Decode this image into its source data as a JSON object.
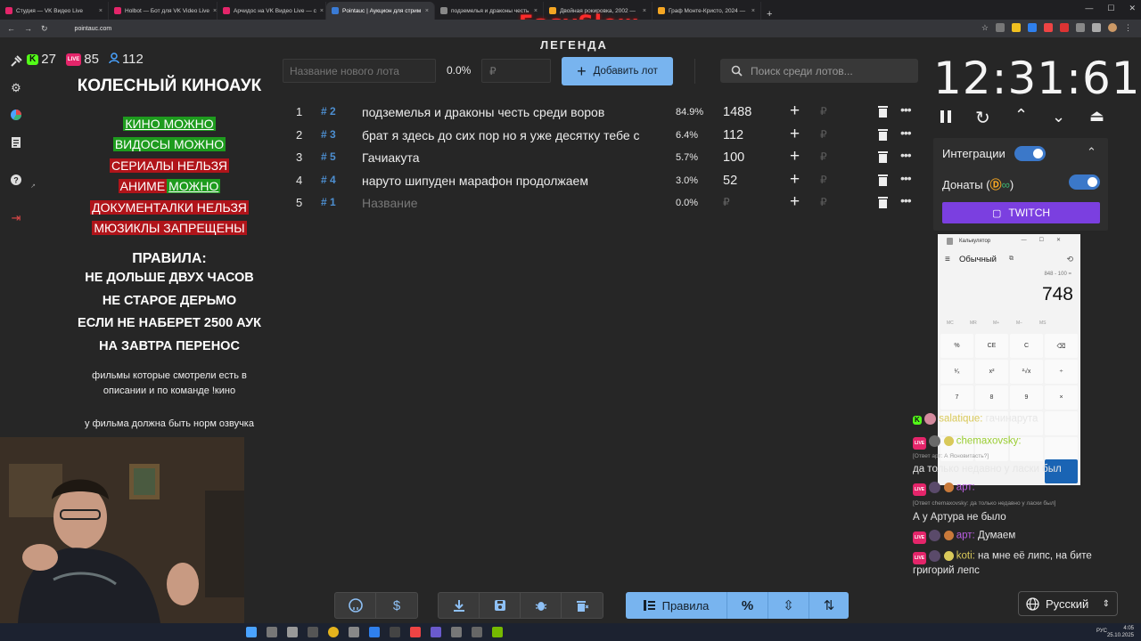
{
  "browser": {
    "tabs": [
      {
        "title": "Студия — VK Видео Live",
        "color": "#e4256a"
      },
      {
        "title": "Holbot — Бот для VK Video Live",
        "color": "#e4256a"
      },
      {
        "title": "Арчидос на VK Видео Live — с",
        "color": "#e4256a"
      },
      {
        "title": "Pointauc | Аукцион для стрим",
        "color": "#3a7bd5"
      },
      {
        "title": "подземелья и драконы честь",
        "color": "#888888"
      },
      {
        "title": "Двойная рокировка, 2002 —",
        "color": "#f5a623"
      },
      {
        "title": "Граф Монте-Кристо, 2024 —",
        "color": "#f5a623"
      }
    ],
    "url": "pointauc.com",
    "overlay_brand": "EasySlow"
  },
  "page": {
    "legend": "ЛЕГЕНДА"
  },
  "counters": {
    "kick": "27",
    "vk_live": "85",
    "viewers": "112",
    "kick_badge": "K",
    "live_badge": "LIVE"
  },
  "sidebar_icons": [
    "gavel-icon",
    "settings-icon",
    "chart-icon",
    "clipboard-icon",
    "help-icon",
    "logout-icon"
  ],
  "rules_panel": {
    "title": "КОЛЕСНЫЙ КИНОАУК",
    "lines": [
      {
        "text": "КИНО МОЖНО",
        "color": "green"
      },
      {
        "text": "ВИДОСЫ МОЖНО",
        "color": "green"
      },
      {
        "text": "СЕРИАЛЫ НЕЛЬЗЯ",
        "color": "red"
      },
      {
        "text_a": "АНИМЕ",
        "text_b": "МОЖНО"
      },
      {
        "text": "ДОКУМЕНТАЛКИ НЕЛЬЗЯ",
        "color": "red"
      },
      {
        "text": "МЮЗИКЛЫ ЗАПРЕЩЕНЫ",
        "color": "red"
      }
    ],
    "rules_heading": "ПРАВИЛА:",
    "rules": [
      "НЕ ДОЛЬШЕ ДВУХ ЧАСОВ",
      "НЕ СТАРОЕ ДЕРЬМО",
      "ЕСЛИ НЕ НАБЕРЕТ 2500 АУК",
      "НА ЗАВТРА ПЕРЕНОС"
    ],
    "note1_a": "фильмы которые смотрели есть в",
    "note1_b": "описании и по команде !кино",
    "note2": "у фильма должна быть норм озвучка"
  },
  "lot_form": {
    "name_placeholder": "Название нового лота",
    "percent": "0.0%",
    "amount_placeholder": "₽",
    "add_label": "Добавить лот",
    "search_placeholder": "Поиск среди лотов..."
  },
  "lots": [
    {
      "index": "1",
      "id": "# 2",
      "name": "подземелья и драконы честь среди воров",
      "percent": "84.9%",
      "amount": "1488",
      "rub": "₽"
    },
    {
      "index": "2",
      "id": "# 3",
      "name": "брат я здесь до сих пор но я уже десятку тебе с",
      "percent": "6.4%",
      "amount": "112",
      "rub": "₽"
    },
    {
      "index": "3",
      "id": "# 5",
      "name": "Гачиакута",
      "percent": "5.7%",
      "amount": "100",
      "rub": "₽"
    },
    {
      "index": "4",
      "id": "# 4",
      "name": "наруто шипуден марафон продолжаем",
      "percent": "3.0%",
      "amount": "52",
      "rub": "₽"
    },
    {
      "index": "5",
      "id": "# 1",
      "name": "Название",
      "percent": "0.0%",
      "amount": "₽",
      "rub": "₽",
      "placeholder": true
    }
  ],
  "timer": {
    "value": "12:31:61"
  },
  "integrations": {
    "label": "Интеграции",
    "donations_label": "Донаты (",
    "donations_suffix": ")",
    "twitch_label": "TWITCH",
    "integrations_on": true,
    "donations_on": true
  },
  "calculator": {
    "title": "Калькулятор",
    "mode": "Обычный",
    "expression": "848 - 100 =",
    "result": "748",
    "memory": [
      "MC",
      "MR",
      "M+",
      "M−",
      "MS"
    ],
    "keys": [
      "%",
      "CE",
      "C",
      "⌫",
      "¹⁄ₓ",
      "x²",
      "²√x",
      "÷",
      "7",
      "8",
      "9",
      "×"
    ]
  },
  "chat": {
    "messages": [
      {
        "user": "salatique:",
        "text": "гачинарута",
        "user_color": "#d9c95a"
      },
      {
        "user": "chemaxovsky:",
        "text": "",
        "user_color": "#9acd32"
      },
      {
        "reply": "[Ответ арт: А Ясновитасть?]",
        "text": "да только недавно у ласки был"
      },
      {
        "user": "арт:",
        "text": "",
        "user_color": "#b85ee0"
      },
      {
        "reply": "[Ответ chemaxovsky: да только недавно у ласки был]",
        "text": "А у Артура не было"
      },
      {
        "user": "арт:",
        "text": "Думаем",
        "user_color": "#b85ee0"
      },
      {
        "user": "koti:",
        "text": "на мне её липс, на бите",
        "text2": "григорий лепс",
        "user_color": "#d9c95a"
      }
    ]
  },
  "toolbar": {
    "rules_label": "Правила",
    "percent_label": "%"
  },
  "language": {
    "label": "Русский"
  },
  "taskbar": {
    "time": "4:05",
    "date": "25.10.2025",
    "lang": "РУС"
  }
}
